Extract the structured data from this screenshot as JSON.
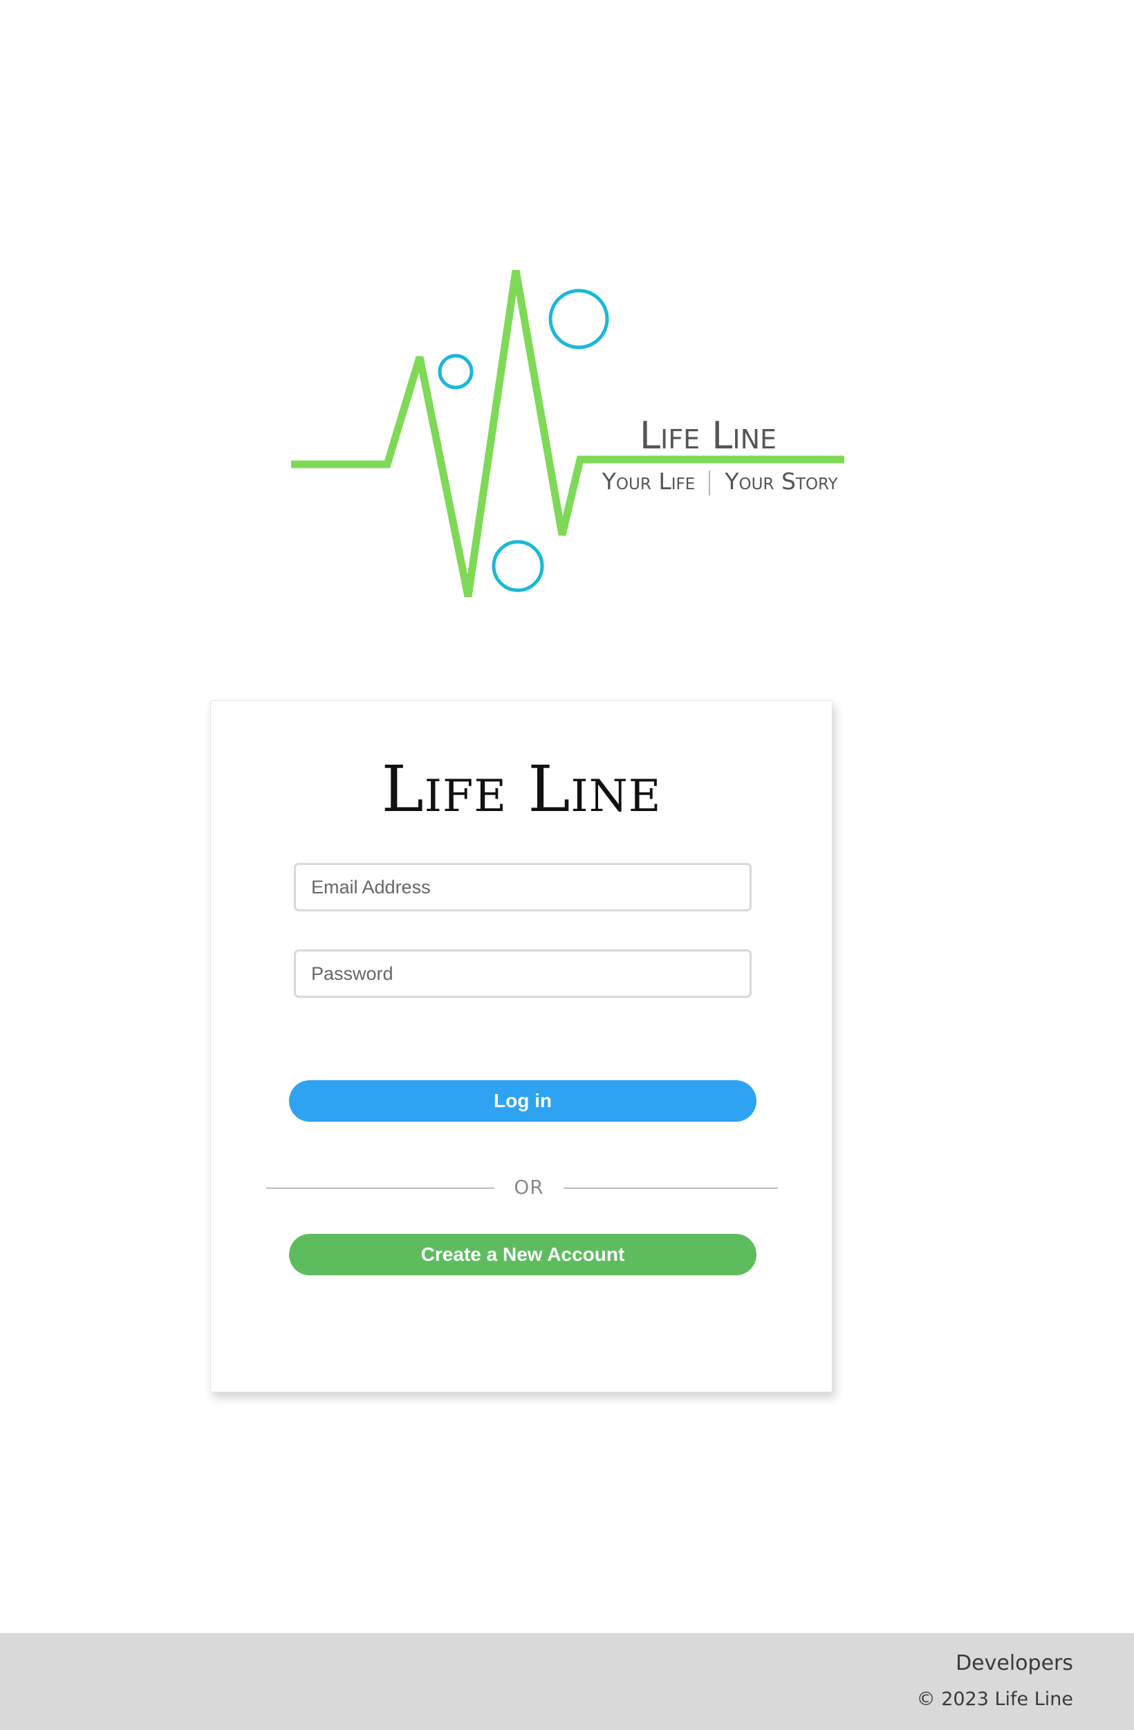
{
  "logo": {
    "title": "Life Line",
    "tagline_left": "Your Life",
    "tagline_right": "Your Story",
    "line_color": "#7ed957",
    "circle_color": "#1ab8d8"
  },
  "login_card": {
    "title": "Life Line",
    "email_placeholder": "Email Address",
    "password_placeholder": "Password",
    "login_label": "Log in",
    "divider_label": "OR",
    "create_account_label": "Create a New Account"
  },
  "footer": {
    "developers_label": "Developers",
    "copyright": "© 2023 Life Line"
  },
  "colors": {
    "login_button": "#2ea3f2",
    "create_button": "#5dbd5e",
    "footer_bg": "#d9d9d9"
  }
}
